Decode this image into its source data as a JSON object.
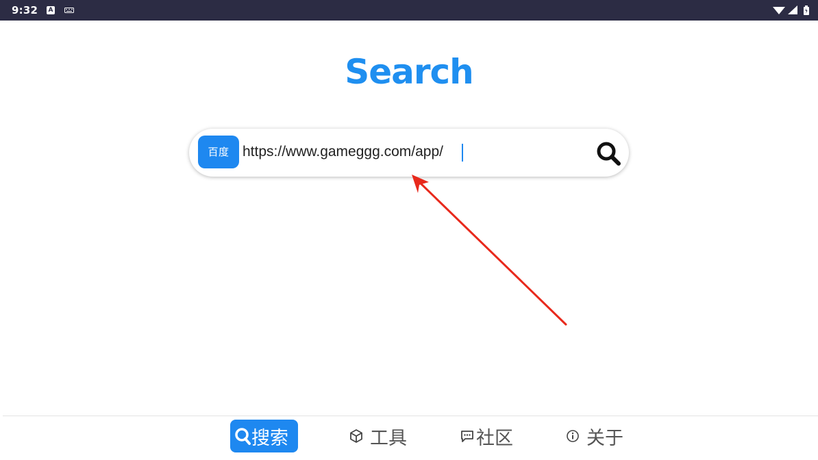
{
  "status_bar": {
    "time": "9:32",
    "left_icons": [
      "a-notification-icon",
      "keyboard-icon"
    ],
    "right_icons": [
      "wifi-icon",
      "cell-signal-icon",
      "battery-icon"
    ]
  },
  "title": "Search",
  "search": {
    "engine_label": "百度",
    "value": "https://www.gameggg.com/app/",
    "button_icon": "search-icon"
  },
  "nav": {
    "items": [
      {
        "label": "搜索",
        "icon": "search-icon",
        "active": true
      },
      {
        "label": "工具",
        "icon": "cube-icon",
        "active": false
      },
      {
        "label": "社区",
        "icon": "chat-icon",
        "active": false
      },
      {
        "label": "关于",
        "icon": "info-icon",
        "active": false
      }
    ]
  },
  "colors": {
    "accent": "#1e88f0",
    "status_bar": "#2c2c44",
    "annotation": "#e8291c"
  }
}
